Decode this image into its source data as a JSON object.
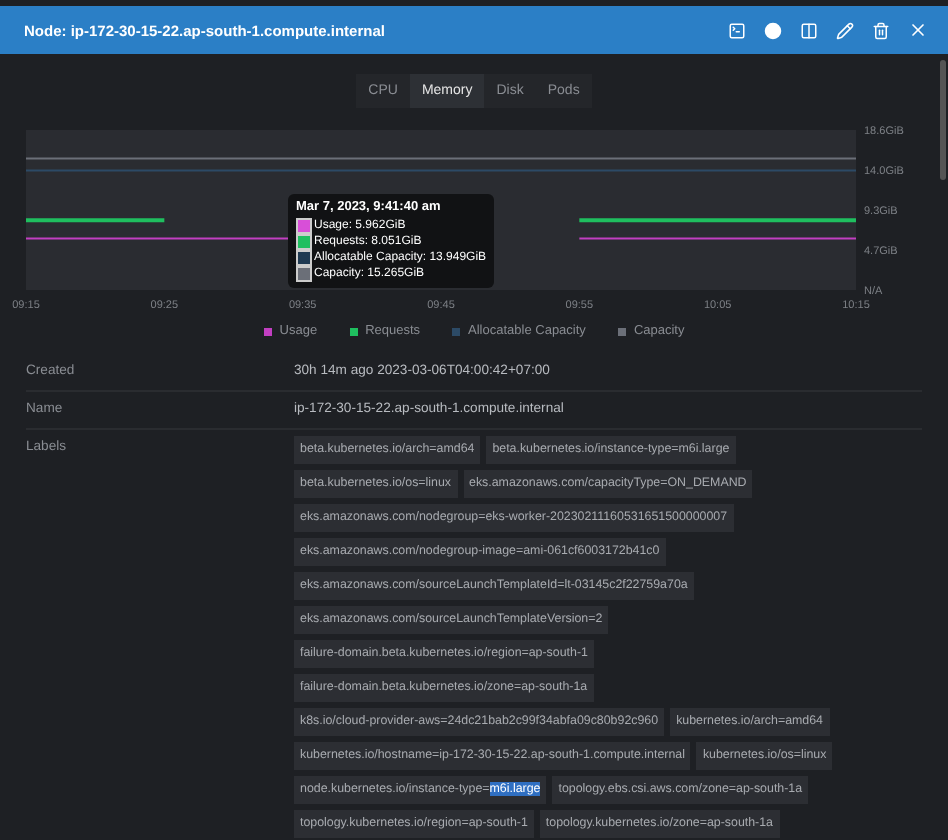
{
  "window": {
    "title": "Node: ip-172-30-15-22.ap-south-1.compute.internal"
  },
  "tabs": [
    {
      "label": "CPU",
      "selected": false
    },
    {
      "label": "Memory",
      "selected": true
    },
    {
      "label": "Disk",
      "selected": false
    },
    {
      "label": "Pods",
      "selected": false
    }
  ],
  "chart_data": {
    "type": "line",
    "categories": [
      "09:15",
      "09:25",
      "09:35",
      "09:45",
      "09:55",
      "10:05",
      "10:15"
    ],
    "ylim": [
      0,
      18.6
    ],
    "yticks": [
      {
        "value": 0,
        "label": "N/A"
      },
      {
        "value": 4.65,
        "label": "4.7GiB"
      },
      {
        "value": 9.3,
        "label": "9.3GiB"
      },
      {
        "value": 13.95,
        "label": "14.0GiB"
      },
      {
        "value": 18.6,
        "label": "18.6GiB"
      }
    ],
    "series": [
      {
        "name": "Usage",
        "color": "#c23fc2",
        "values": [
          6.0,
          6.0,
          6.0,
          null,
          6.0,
          6.0,
          6.0
        ]
      },
      {
        "name": "Requests",
        "color": "#1fbf5f",
        "values": [
          8.1,
          8.1,
          null,
          null,
          8.1,
          8.1,
          8.1
        ]
      },
      {
        "name": "Allocatable Capacity",
        "color": "#2c4a66",
        "values": [
          13.9,
          13.9,
          13.9,
          13.9,
          13.9,
          13.9,
          13.9
        ]
      },
      {
        "name": "Capacity",
        "color": "#6b6f78",
        "values": [
          15.3,
          15.3,
          15.3,
          15.3,
          15.3,
          15.3,
          15.3
        ]
      }
    ]
  },
  "tooltip": {
    "title": "Mar 7, 2023, 9:41:40 am",
    "lines": [
      {
        "text": "Usage: 5.962GiB",
        "color": "#d84fd8"
      },
      {
        "text": "Requests: 8.051GiB",
        "color": "#1fbf5f"
      },
      {
        "text": "Allocatable Capacity: 13.949GiB",
        "color": "#1f3a52"
      },
      {
        "text": "Capacity: 15.265GiB",
        "color": "#6b6f78"
      }
    ]
  },
  "details": [
    {
      "label": "Created",
      "value": "30h 14m ago 2023-03-06T04:00:42+07:00"
    },
    {
      "label": "Name",
      "value": "ip-172-30-15-22.ap-south-1.compute.internal"
    }
  ],
  "labels": {
    "label": "Labels",
    "tags": [
      {
        "text": "beta.kubernetes.io/arch=amd64"
      },
      {
        "text": "beta.kubernetes.io/instance-type=m6i.large"
      },
      {
        "text": "beta.kubernetes.io/os=linux"
      },
      {
        "text": "eks.amazonaws.com/capacityType=ON_DEMAND"
      },
      {
        "text": "eks.amazonaws.com/nodegroup=eks-worker-20230211160531651500000007"
      },
      {
        "text": "eks.amazonaws.com/nodegroup-image=ami-061cf6003172b41c0"
      },
      {
        "text": "eks.amazonaws.com/sourceLaunchTemplateId=lt-03145c2f22759a70a"
      },
      {
        "text": "eks.amazonaws.com/sourceLaunchTemplateVersion=2"
      },
      {
        "text": "failure-domain.beta.kubernetes.io/region=ap-south-1"
      },
      {
        "text": "failure-domain.beta.kubernetes.io/zone=ap-south-1a"
      },
      {
        "text": "k8s.io/cloud-provider-aws=24dc21bab2c99f34abfa09c80b92c960"
      },
      {
        "text": "kubernetes.io/arch=amd64"
      },
      {
        "text": "kubernetes.io/hostname=ip-172-30-15-22.ap-south-1.compute.internal"
      },
      {
        "text": "kubernetes.io/os=linux"
      },
      {
        "text": "node.kubernetes.io/instance-type=",
        "highlight": "m6i.large"
      },
      {
        "text": "topology.ebs.csi.aws.com/zone=ap-south-1a"
      },
      {
        "text": "topology.kubernetes.io/region=ap-south-1"
      },
      {
        "text": "topology.kubernetes.io/zone=ap-south-1a"
      }
    ]
  }
}
